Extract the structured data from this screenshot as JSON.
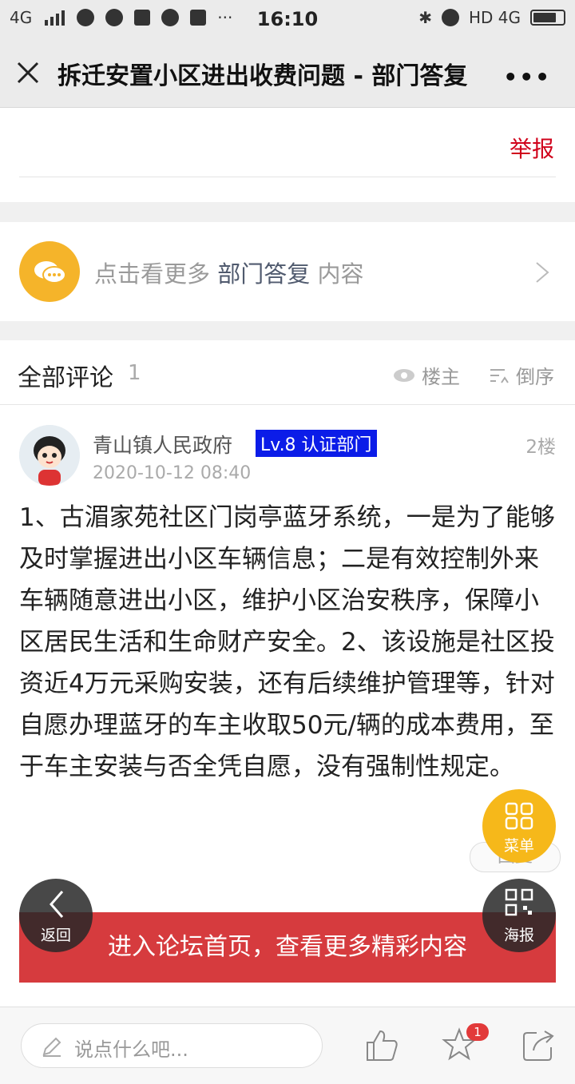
{
  "status_bar": {
    "network": "4G",
    "time": "16:10",
    "right_text": "HD 4G"
  },
  "nav": {
    "title": "拆迁安置小区进出收费问题 - 部门答复",
    "more": "•••"
  },
  "report": {
    "label": "举报"
  },
  "see_more": {
    "prefix": "点击看更多",
    "highlight": "部门答复",
    "suffix": "内容"
  },
  "comments": {
    "title": "全部评论",
    "count": "1",
    "owner_label": "楼主",
    "order_label": "倒序",
    "items": [
      {
        "author": "青山镇人民政府",
        "badge": "Lv.8 认证部门",
        "floor": "2楼",
        "time": "2020-10-12 08:40",
        "body": "1、古湄家苑社区门岗亭蓝牙系统，一是为了能够及时掌握进出小区车辆信息；二是有效控制外来车辆随意进出小区，维护小区治安秩序，保障小区居民生活和生命财产安全。2、该设施是社区投资近4万元采购安装，还有后续维护管理等，针对自愿办理蓝牙的车主收取50元/辆的成本费用，至于车主安装与否全凭自愿，没有强制性规定。",
        "reply_label": "回复"
      }
    ]
  },
  "forum_button": {
    "label": "进入论坛首页，查看更多精彩内容"
  },
  "fabs": {
    "menu": "菜单",
    "back": "返回",
    "poster": "海报"
  },
  "bottom_bar": {
    "placeholder": "说点什么吧...",
    "favorite_count": "1"
  },
  "colors": {
    "report_red": "#d0021b",
    "badge_blue": "#0b1ce8",
    "forum_red": "#d63b3e",
    "menu_yellow": "#f6b81a",
    "seemore_yellow": "#f5b42a"
  }
}
